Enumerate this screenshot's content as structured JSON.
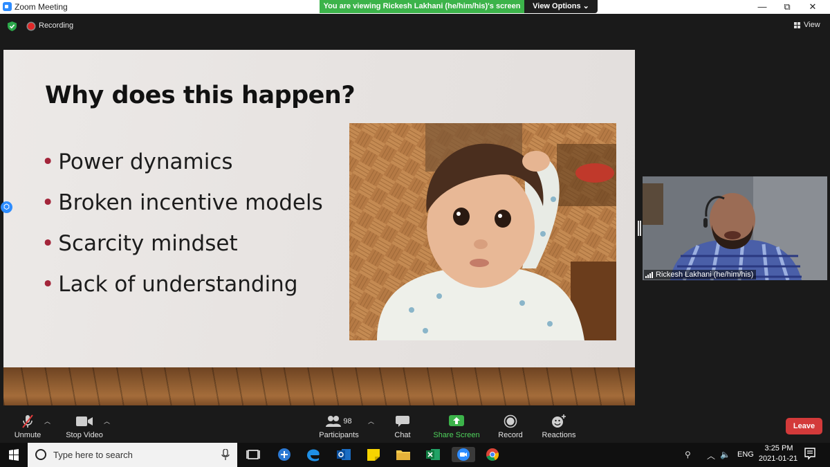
{
  "window": {
    "title": "Zoom Meeting",
    "share_banner": "You are viewing Rickesh Lakhani (he/him/his)'s screen",
    "view_options": "View Options ⌄"
  },
  "meeting": {
    "recording_label": "Recording",
    "view_label": "View"
  },
  "slide": {
    "title": "Why does this happen?",
    "bullets": [
      "Power dynamics",
      "Broken incentive models",
      "Scarcity mindset",
      "Lack of understanding"
    ],
    "bullet_color": "#a3253a"
  },
  "participant": {
    "name": "Rickesh Lakhani (he/him/his)"
  },
  "toolbar": {
    "unmute": "Unmute",
    "stop_video": "Stop Video",
    "participants": "Participants",
    "participants_count": "98",
    "chat": "Chat",
    "share_screen": "Share Screen",
    "record": "Record",
    "reactions": "Reactions",
    "leave": "Leave",
    "share_color": "#3cb34a",
    "leave_color": "#d33a3a"
  },
  "taskbar": {
    "search_placeholder": "Type here to search",
    "language": "ENG",
    "time": "3:25 PM",
    "date": "2021-01-21"
  }
}
